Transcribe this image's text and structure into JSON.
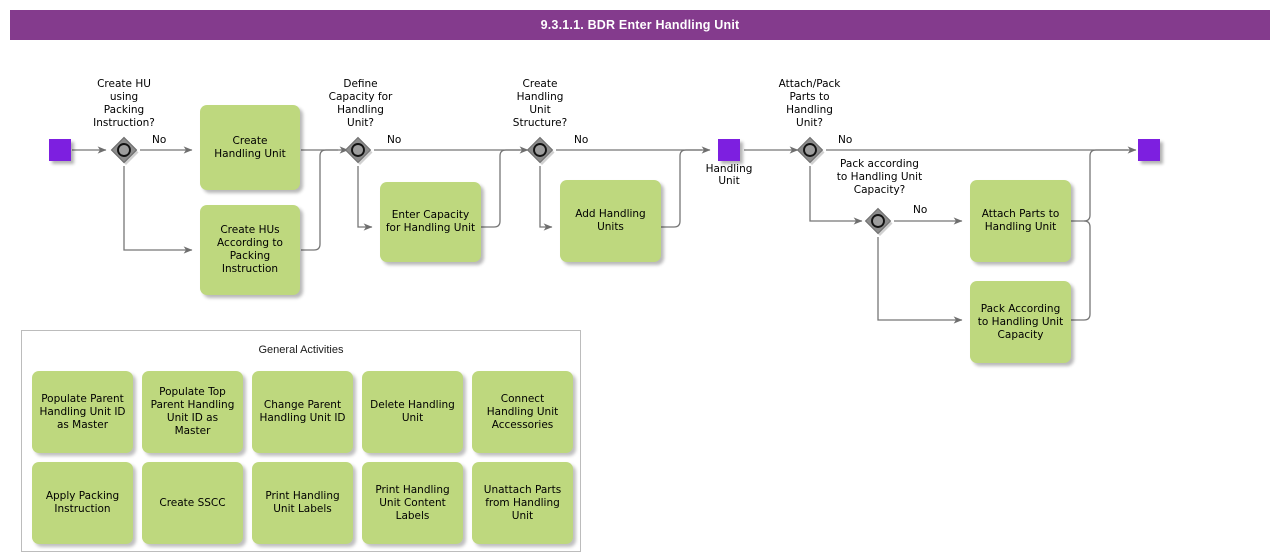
{
  "title": "9.3.1.1. BDR Enter Handling Unit",
  "colors": {
    "header_purple": "#843b8d",
    "event_purple": "#7d1fe0",
    "task_green": "#bed87e",
    "gateway_gray": "#808080",
    "connector_gray": "#767676"
  },
  "flow": {
    "start_event": {
      "label": ""
    },
    "intermediate_event": {
      "label": "Handling\nUnit"
    },
    "end_event": {
      "label": ""
    },
    "gateways": [
      {
        "id": "gw1",
        "label": "Create HU\nusing\nPacking\nInstruction?",
        "branch_label": "No"
      },
      {
        "id": "gw2",
        "label": "Define\nCapacity for\nHandling\nUnit?",
        "branch_label": "No"
      },
      {
        "id": "gw3",
        "label": "Create\nHandling\nUnit\nStructure?",
        "branch_label": "No"
      },
      {
        "id": "gw4",
        "label": "Attach/Pack\nParts to\nHandling\nUnit?",
        "branch_label": "No"
      },
      {
        "id": "gw5",
        "label": "Pack according\nto Handling Unit\nCapacity?",
        "branch_label": "No"
      }
    ],
    "tasks": [
      {
        "id": "t1",
        "label": "Create\nHandling Unit"
      },
      {
        "id": "t2",
        "label": "Create HUs\nAccording to\nPacking\nInstruction"
      },
      {
        "id": "t3",
        "label": "Enter Capacity\nfor Handling Unit"
      },
      {
        "id": "t4",
        "label": "Add Handling\nUnits"
      },
      {
        "id": "t5",
        "label": "Attach Parts to\nHandling Unit"
      },
      {
        "id": "t6",
        "label": "Pack According\nto Handling Unit\nCapacity"
      }
    ]
  },
  "general_activities": {
    "title": "General Activities",
    "items": [
      {
        "label": "Populate Parent\nHandling Unit ID\nas Master"
      },
      {
        "label": "Populate Top\nParent Handling\nUnit ID as\nMaster"
      },
      {
        "label": "Change Parent\nHandling Unit ID"
      },
      {
        "label": "Delete Handling\nUnit"
      },
      {
        "label": "Connect\nHandling Unit\nAccessories"
      },
      {
        "label": "Apply Packing\nInstruction"
      },
      {
        "label": "Create SSCC"
      },
      {
        "label": "Print Handling\nUnit Labels"
      },
      {
        "label": "Print Handling\nUnit Content\nLabels"
      },
      {
        "label": "Unattach Parts\nfrom Handling\nUnit"
      }
    ]
  }
}
